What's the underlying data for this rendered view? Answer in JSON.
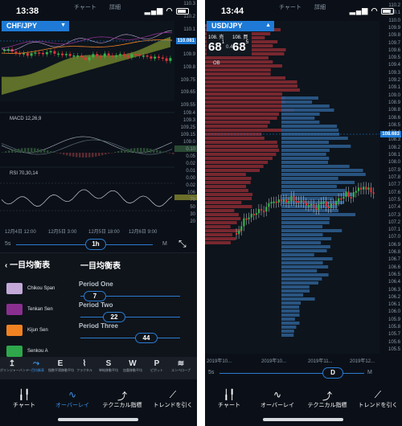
{
  "left": {
    "status_time": "13:38",
    "top_tabs": [
      "チャート",
      "詳細"
    ],
    "symbol": "CHF/JPY",
    "price_tag": "110.081",
    "price_axis": [
      "110.3",
      "110.2",
      "110.1",
      "110.0",
      "109.9",
      "109.8",
      "109.75",
      "109.65",
      "109.55",
      "109.4",
      "109.3",
      "109.25",
      "109.15",
      "109.0"
    ],
    "macd_label": "MACD 12,26,9",
    "macd_axis": [
      "0.10",
      "0.05",
      "0.02",
      "0.01",
      "0.00",
      "0.02"
    ],
    "rsi_label": "RSI 70,30,14",
    "rsi_axis": [
      "106",
      "70",
      "50",
      "30",
      "20"
    ],
    "time_axis": [
      "12月4日 12:00",
      "12月5日 3:00",
      "12月5日 18:00",
      "12月6日 9:00"
    ],
    "slider": {
      "min": "5s",
      "value": "1h",
      "max": "M"
    },
    "panel": {
      "back": "一目均衡表",
      "title": "一目均衡表",
      "lines": [
        {
          "name": "Chikou Span",
          "color": "#c3a8d8"
        },
        {
          "name": "Tenkan Sen",
          "color": "#8a2f8f"
        },
        {
          "name": "Kijun Sen",
          "color": "#f08222"
        },
        {
          "name": "Senkou A",
          "color": "#2ea84a"
        }
      ],
      "periods": [
        {
          "label": "Period One",
          "value": "7"
        },
        {
          "label": "Period Two",
          "value": "22"
        },
        {
          "label": "Period Three",
          "value": "44"
        }
      ]
    },
    "indicator_tools": [
      {
        "icon": "↥",
        "label": "ボリンジャーバンド"
      },
      {
        "icon": "⤳",
        "label": "一目均衡表"
      },
      {
        "icon": "E",
        "label": "指数平滑移動平均"
      },
      {
        "icon": "⌇",
        "label": "フラクタル"
      },
      {
        "icon": "S",
        "label": "単純移動平均"
      },
      {
        "icon": "W",
        "label": "加重移動平均"
      },
      {
        "icon": "P",
        "label": "ピボット"
      },
      {
        "icon": "≋",
        "label": "エンベロープ"
      }
    ]
  },
  "right": {
    "status_time": "13:44",
    "top_tabs": [
      "チャート",
      "詳細"
    ],
    "symbol": "USD/JPY",
    "quote": {
      "sell_int": "108.",
      "sell_big": "68",
      "sell_sup": "1",
      "spread": "0.4",
      "buy_int": "108.",
      "buy_big": "68",
      "buy_sup": "5",
      "sell_label": "売",
      "buy_label": "買"
    },
    "ob_label": "OB",
    "price_tag": "108.683",
    "price_axis": [
      "110.2",
      "110.1",
      "110.0",
      "109.9",
      "109.8",
      "109.7",
      "109.6",
      "109.5",
      "109.4",
      "109.3",
      "109.2",
      "109.1",
      "109.0",
      "108.9",
      "108.8",
      "108.6",
      "108.5",
      "108.4",
      "108.3",
      "108.2",
      "108.1",
      "108.0",
      "107.9",
      "107.8",
      "107.7",
      "107.6",
      "107.5",
      "107.4",
      "107.3",
      "107.2",
      "107.1",
      "107.0",
      "106.9",
      "106.8",
      "106.7",
      "106.6",
      "106.5",
      "106.4",
      "106.3",
      "106.2",
      "106.1",
      "106.0",
      "105.9",
      "105.8",
      "105.7",
      "105.6",
      "105.5"
    ],
    "time_axis": [
      "2019年10...",
      "2019年10...",
      "2019年11...",
      "2019年12..."
    ],
    "slider": {
      "min": "5s",
      "value": "D",
      "max": "M"
    }
  },
  "tabbar": [
    "チャート",
    "オーバーレイ",
    "テクニカル指標",
    "トレンドを引く"
  ],
  "colors": {
    "accent": "#1e7ad6",
    "bull": "#35b44a",
    "bear": "#e1333b",
    "cloud": "#7a8f2e"
  }
}
